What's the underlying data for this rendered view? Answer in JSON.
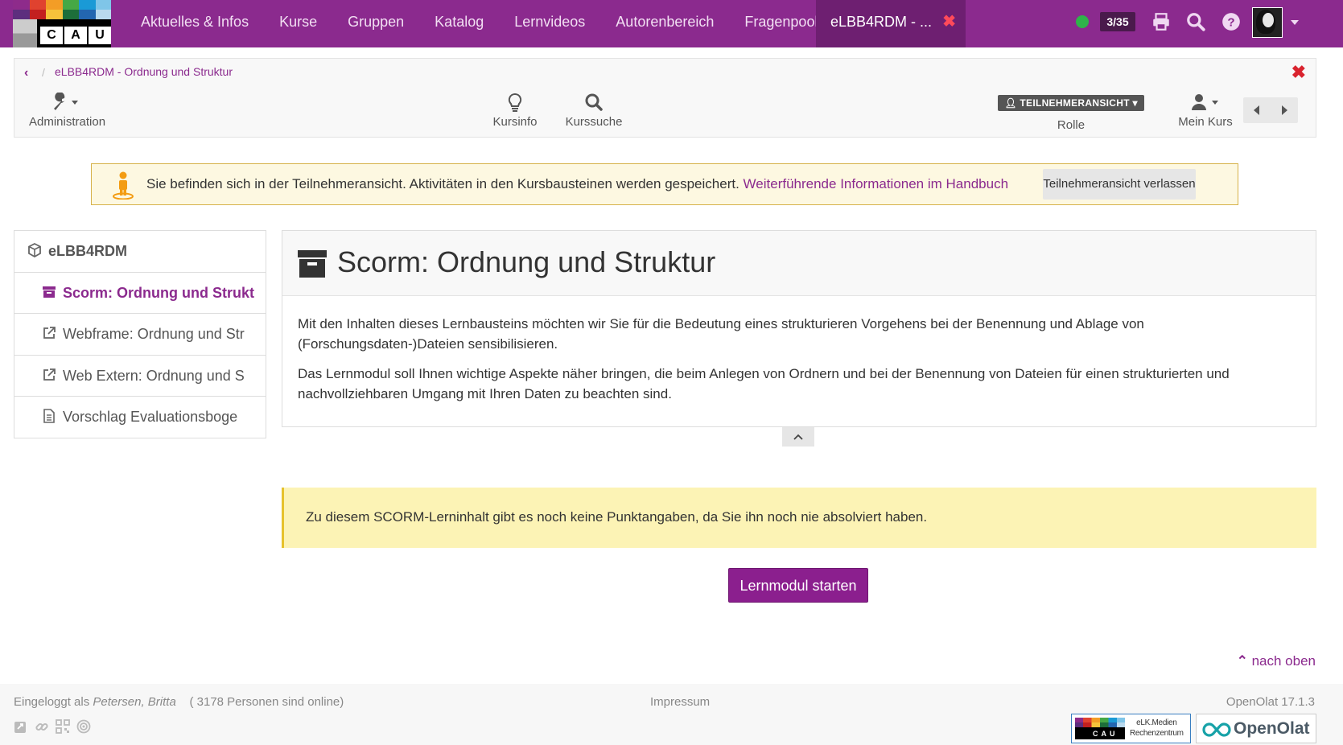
{
  "topnav": {
    "logo_text": "CAU",
    "items": [
      "Aktuelles & Infos",
      "Kurse",
      "Gruppen",
      "Katalog",
      "Lernvideos",
      "Autorenbereich",
      "Fragenpool"
    ],
    "active_tab": "eLBB4RDM - ...",
    "counter": "3/35",
    "accent_color": "#8b2a8e"
  },
  "toolbar": {
    "breadcrumb": "eLBB4RDM - Ordnung und Struktur",
    "administration": "Administration",
    "kursinfo": "Kursinfo",
    "kurssuche": "Kurssuche",
    "role_badge": "TEILNEHMERANSICHT",
    "role_label": "Rolle",
    "mein_kurs": "Mein Kurs"
  },
  "notice": {
    "text": "Sie befinden sich in der Teilnehmeransicht. Aktivitäten in den Kursbausteinen werden gespeichert.",
    "link": "Weiterführende Informationen im Handbuch",
    "button": "Teilnehmeransicht verlassen"
  },
  "menu": {
    "root": "eLBB4RDM",
    "items": [
      {
        "label": "Scorm: Ordnung und Strukt",
        "icon": "archive-icon"
      },
      {
        "label": "Webframe: Ordnung und Str",
        "icon": "external-link-icon"
      },
      {
        "label": "Web Extern: Ordnung und S",
        "icon": "external-link-icon"
      },
      {
        "label": "Vorschlag Evaluationsboge",
        "icon": "document-icon"
      }
    ]
  },
  "content": {
    "title": "Scorm: Ordnung und Struktur",
    "para1": "Mit den Inhalten dieses Lernbausteins möchten wir Sie für die Bedeutung eines strukturieren Vorgehens bei der Benennung und Ablage von (Forschungsdaten-)Dateien sensibilisieren.",
    "para2": "Das Lernmodul soll Ihnen wichtige Aspekte näher bringen, die beim Anlegen von Ordnern und bei der Benennung von Dateien für einen strukturierten und nachvollziehbaren Umgang mit Ihren Daten zu beachten sind.",
    "info": "Zu diesem SCORM-Lerninhalt gibt es noch keine Punktangaben, da Sie ihn noch nie absolviert haben.",
    "start_button": "Lernmodul starten",
    "to_top": "nach oben"
  },
  "footer": {
    "logged_prefix": "Eingeloggt als",
    "user": "Petersen, Britta",
    "online": "( 3178 Personen sind online)",
    "impressum": "Impressum",
    "version": "OpenOlat 17.1.3",
    "elk_line1": "eLK.Medien",
    "elk_line2": "Rechenzentrum",
    "openolat_logo": "OpenOlat"
  }
}
